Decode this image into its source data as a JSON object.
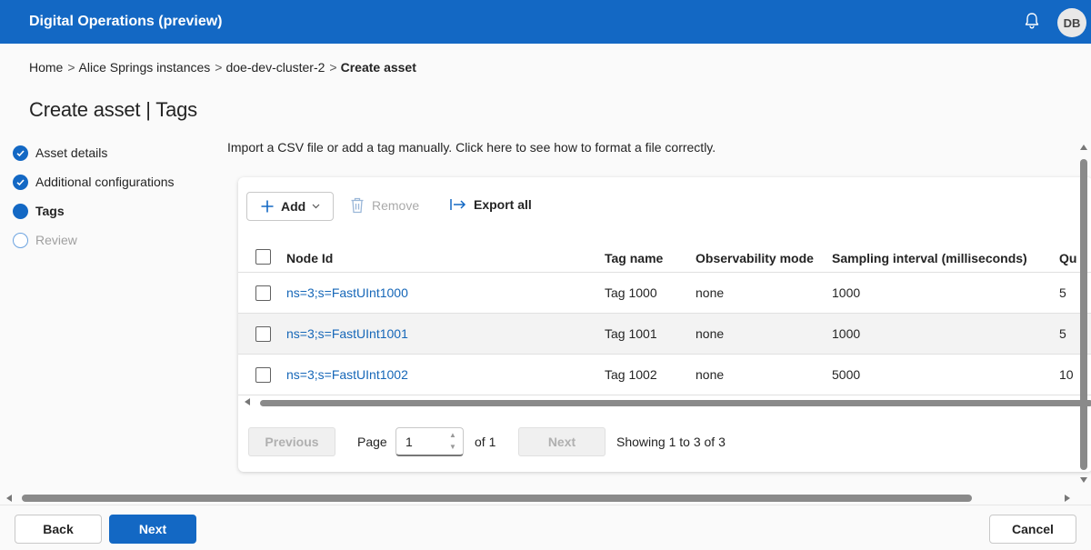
{
  "app": {
    "title": "Digital Operations (preview)",
    "avatar_initials": "DB"
  },
  "breadcrumb": {
    "items": [
      "Home",
      "Alice Springs instances",
      "doe-dev-cluster-2",
      "Create asset"
    ],
    "separator": ">"
  },
  "page": {
    "title": "Create asset | Tags"
  },
  "steps": [
    {
      "label": "Asset details",
      "state": "done"
    },
    {
      "label": "Additional configurations",
      "state": "done"
    },
    {
      "label": "Tags",
      "state": "active"
    },
    {
      "label": "Review",
      "state": "pending"
    }
  ],
  "intro_text": "Import a CSV file or add a tag manually. Click here to see how to format a file correctly.",
  "toolbar": {
    "add_label": "Add",
    "remove_label": "Remove",
    "export_label": "Export all"
  },
  "table": {
    "columns": [
      "Node Id",
      "Tag name",
      "Observability mode",
      "Sampling interval (milliseconds)",
      "Qu"
    ],
    "rows": [
      {
        "node_id": "ns=3;s=FastUInt1000",
        "tag_name": "Tag 1000",
        "observability": "none",
        "sampling": "1000",
        "queue": "5"
      },
      {
        "node_id": "ns=3;s=FastUInt1001",
        "tag_name": "Tag 1001",
        "observability": "none",
        "sampling": "1000",
        "queue": "5"
      },
      {
        "node_id": "ns=3;s=FastUInt1002",
        "tag_name": "Tag 1002",
        "observability": "none",
        "sampling": "5000",
        "queue": "10"
      }
    ]
  },
  "pagination": {
    "previous_label": "Previous",
    "page_label": "Page",
    "page_value": "1",
    "of_label": "of 1",
    "next_label": "Next",
    "showing_text": "Showing 1 to 3 of 3"
  },
  "footer": {
    "back_label": "Back",
    "next_label": "Next",
    "cancel_label": "Cancel"
  },
  "colors": {
    "accent": "#1368c4",
    "link": "#1667b8"
  }
}
